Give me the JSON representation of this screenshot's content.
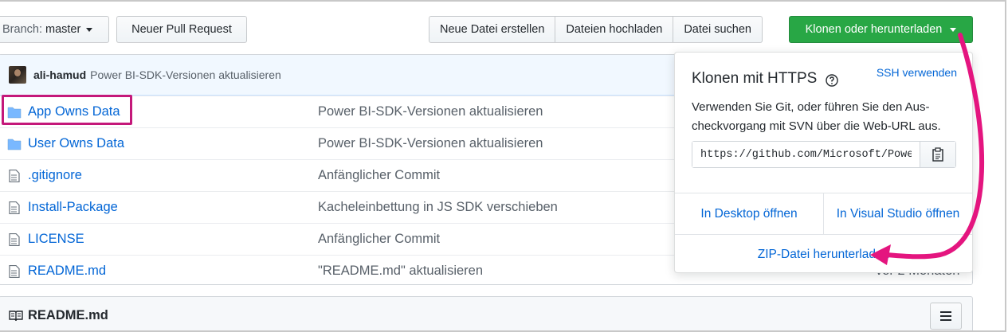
{
  "toolbar": {
    "branch_label": "Branch:",
    "branch_value": "master",
    "new_pr": "Neuer Pull Request",
    "create_file": "Neue Datei erstellen",
    "upload_files": "Dateien hochladen",
    "find_file": "Datei suchen",
    "clone_download": "Klonen oder herunterladen"
  },
  "commit": {
    "author": "ali-hamud",
    "message": "Power BI-SDK-Versionen aktualisieren"
  },
  "files": [
    {
      "name": "App Owns Data",
      "type": "folder",
      "message": "Power BI-SDK-Versionen aktualisieren",
      "age": ""
    },
    {
      "name": "User Owns Data",
      "type": "folder",
      "message": "Power BI-SDK-Versionen aktualisieren",
      "age": ""
    },
    {
      "name": ".gitignore",
      "type": "file",
      "message": "Anfänglicher Commit",
      "age": ""
    },
    {
      "name": "Install-Package",
      "type": "file",
      "message": "Kacheleinbettung in JS SDK verschieben",
      "age": ""
    },
    {
      "name": "LICENSE",
      "type": "file",
      "message": "Anfänglicher Commit",
      "age": ""
    },
    {
      "name": "README.md",
      "type": "file",
      "message": "\"README.md\" aktualisieren",
      "age": "vor 2 Monaten"
    }
  ],
  "readme": {
    "title": "README.md"
  },
  "clone_popup": {
    "title": "Klonen mit HTTPS",
    "ssh_link": "SSH verwenden",
    "description": "Verwenden Sie Git, oder führen Sie den Aus-checkvorgang mit SVN über die Web-URL aus.",
    "url": "https://github.com/Microsoft/PowerBI-Developer-Samples.git",
    "open_desktop": "In Desktop öffnen",
    "open_vs": "In Visual Studio öffnen",
    "download_zip": "ZIP-Datei herunterladen"
  },
  "colors": {
    "accent_green": "#28a745",
    "link_blue": "#0366d6",
    "annotation_magenta": "#e4157f"
  }
}
